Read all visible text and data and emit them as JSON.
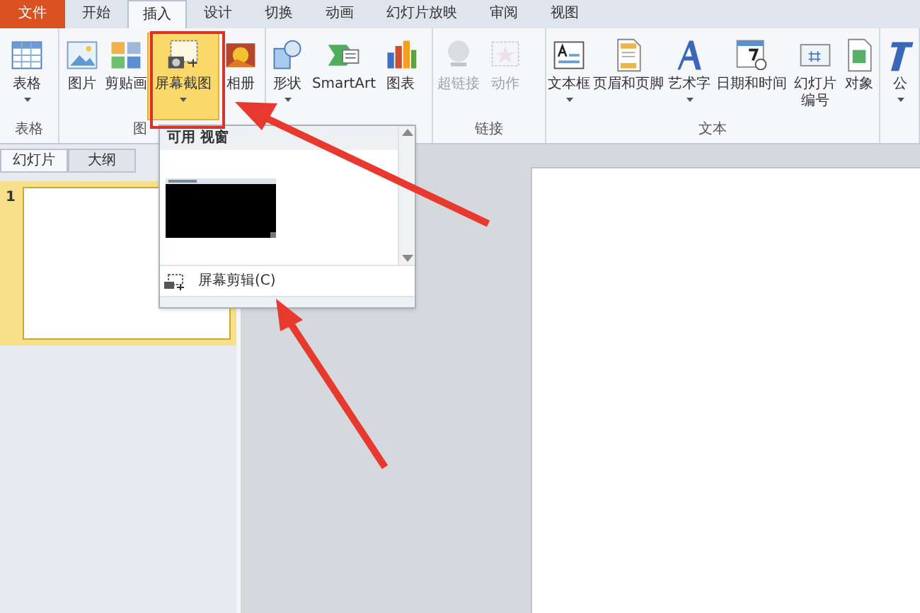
{
  "tabs": [
    {
      "label": "文件",
      "kind": "file",
      "selected": false
    },
    {
      "label": "开始",
      "kind": "tab",
      "selected": false
    },
    {
      "label": "插入",
      "kind": "tab",
      "selected": true
    },
    {
      "label": "设计",
      "kind": "tab",
      "selected": false
    },
    {
      "label": "切换",
      "kind": "tab",
      "selected": false
    },
    {
      "label": "动画",
      "kind": "tab",
      "selected": false
    },
    {
      "label": "幻灯片放映",
      "kind": "tab",
      "selected": false
    },
    {
      "label": "审阅",
      "kind": "tab",
      "selected": false
    },
    {
      "label": "视图",
      "kind": "tab",
      "selected": false
    }
  ],
  "groups": [
    {
      "label": "表格",
      "buttons": [
        {
          "label": "表格",
          "dropdown": true,
          "disabled": false,
          "pressed": false
        }
      ]
    },
    {
      "label": "图",
      "buttons": [
        {
          "label": "图片",
          "dropdown": false,
          "disabled": false,
          "pressed": false
        },
        {
          "label": "剪贴画",
          "dropdown": false,
          "disabled": false,
          "pressed": false
        },
        {
          "label": "屏幕截图",
          "dropdown": true,
          "disabled": false,
          "pressed": true
        },
        {
          "label": "相册",
          "dropdown": false,
          "disabled": false,
          "pressed": false
        }
      ]
    },
    {
      "buttons": [
        {
          "label": "形状",
          "dropdown": true,
          "disabled": false,
          "pressed": false
        },
        {
          "label": "SmartArt",
          "dropdown": false,
          "disabled": false,
          "pressed": false
        },
        {
          "label": "图表",
          "dropdown": false,
          "disabled": false,
          "pressed": false
        }
      ]
    },
    {
      "label": "链接",
      "buttons": [
        {
          "label": "超链接",
          "dropdown": false,
          "disabled": true,
          "pressed": false
        },
        {
          "label": "动作",
          "dropdown": false,
          "disabled": true,
          "pressed": false
        }
      ]
    },
    {
      "label": "文本",
      "buttons": [
        {
          "label": "文本框",
          "dropdown": true,
          "disabled": false,
          "pressed": false
        },
        {
          "label": "页眉和页脚",
          "dropdown": false,
          "disabled": false,
          "pressed": false
        },
        {
          "label": "艺术字",
          "dropdown": true,
          "disabled": false,
          "pressed": false
        },
        {
          "label": "日期和时间",
          "dropdown": false,
          "disabled": false,
          "pressed": false
        },
        {
          "label": "幻灯片编号",
          "dropdown": false,
          "disabled": false,
          "pressed": false
        },
        {
          "label": "对象",
          "dropdown": false,
          "disabled": false,
          "pressed": false
        }
      ]
    },
    {
      "buttons": [
        {
          "label": "公",
          "dropdown": true,
          "disabled": false,
          "pressed": false
        }
      ]
    }
  ],
  "panel_tabs": [
    {
      "label": "幻灯片",
      "selected": true
    },
    {
      "label": "大纲",
      "selected": false
    }
  ],
  "slides": [
    {
      "number": "1",
      "selected": true
    }
  ],
  "dropdown": {
    "header": "可用 视窗",
    "item": "屏幕剪辑(C)"
  }
}
